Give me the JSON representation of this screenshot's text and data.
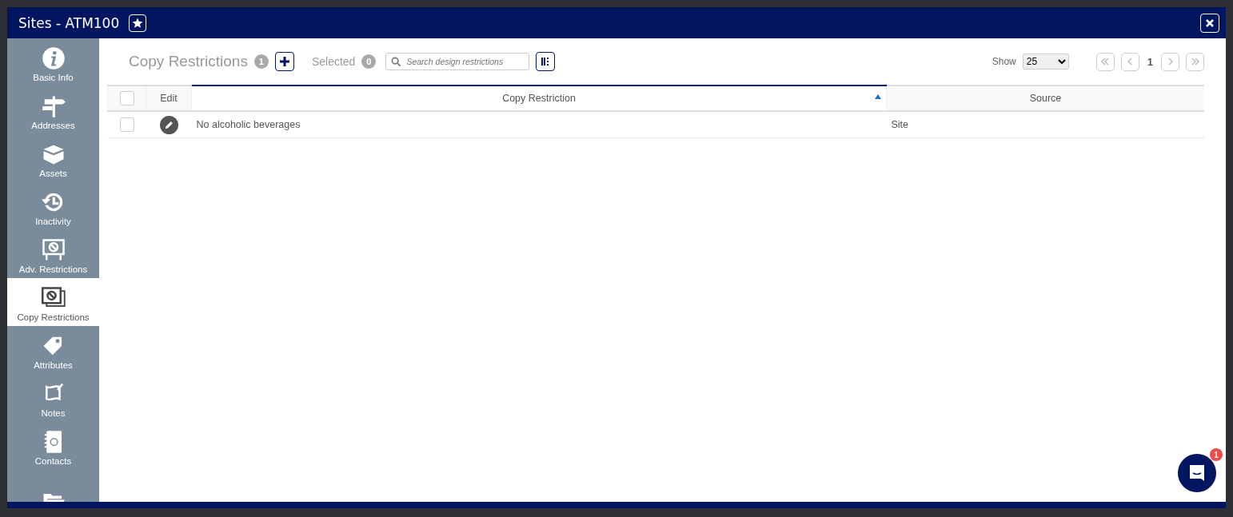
{
  "window": {
    "title": "Sites - ATM100"
  },
  "sidebar": {
    "items": [
      {
        "label": "Basic Info",
        "selected": false
      },
      {
        "label": "Addresses",
        "selected": false
      },
      {
        "label": "Assets",
        "selected": false
      },
      {
        "label": "Inactivity",
        "selected": false
      },
      {
        "label": "Adv. Restrictions",
        "selected": false
      },
      {
        "label": "Copy Restrictions",
        "selected": true
      },
      {
        "label": "Attributes",
        "selected": false
      },
      {
        "label": "Notes",
        "selected": false
      },
      {
        "label": "Contacts",
        "selected": false
      },
      {
        "selected": false
      }
    ]
  },
  "toolbar": {
    "title": "Copy Restrictions",
    "count": "1",
    "selected_label": "Selected",
    "selected_count": "0",
    "search": {
      "placeholder": "Search design restrictions"
    },
    "show_label": "Show",
    "page_size": "25",
    "page": "1"
  },
  "table": {
    "columns": [
      {
        "kind": "checkbox",
        "checked": false
      },
      {
        "kind": "text",
        "label": "Edit",
        "sorted": false
      },
      {
        "kind": "text",
        "label": "Copy Restriction",
        "sorted": true
      },
      {
        "kind": "text",
        "label": "Source",
        "sorted": false
      }
    ],
    "rows": [
      {
        "checked": false,
        "restriction": "No alcoholic beverages",
        "source": "Site"
      }
    ]
  },
  "chat": {
    "badge": "1"
  }
}
